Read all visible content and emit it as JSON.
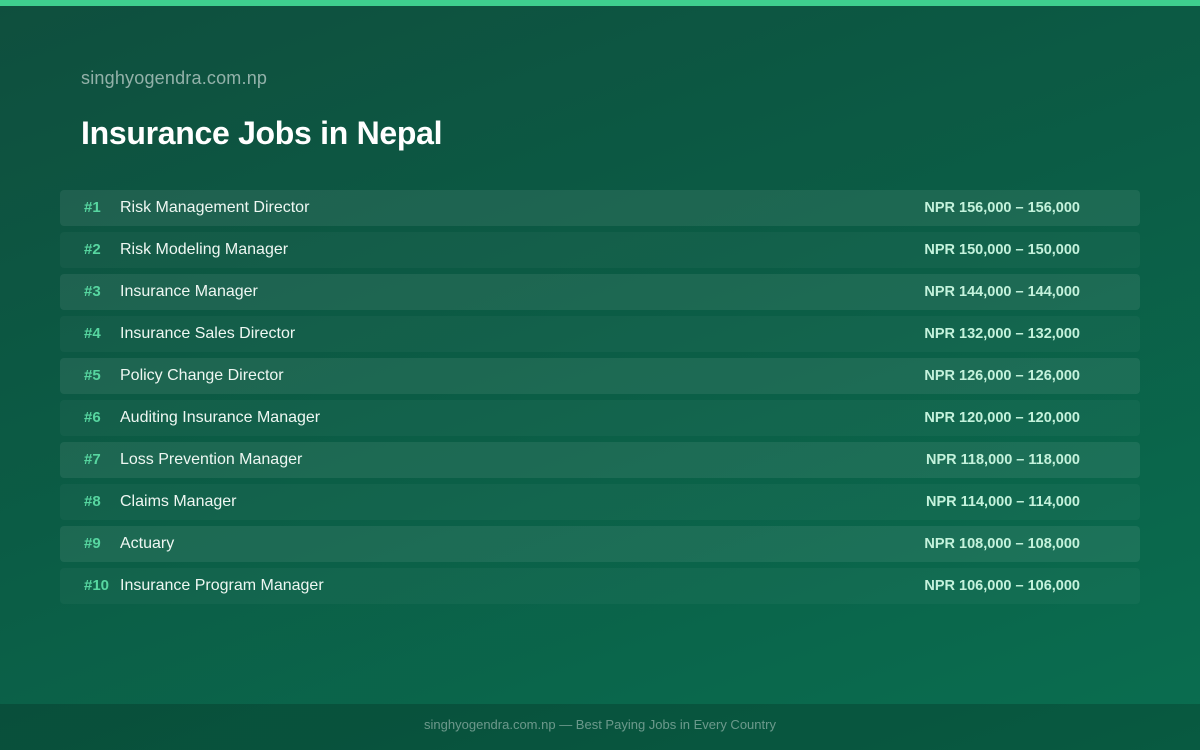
{
  "header": {
    "site_name": "singhyogendra.com.np",
    "title": "Insurance Jobs in Nepal"
  },
  "colors": {
    "accent": "#3ecf8e",
    "rank": "#57d6a0",
    "background_start": "#0f4f3e",
    "background_end": "#0a6e50"
  },
  "jobs": [
    {
      "rank": "#1",
      "title": "Risk Management Director",
      "salary": "NPR 156,000 – 156,000"
    },
    {
      "rank": "#2",
      "title": "Risk Modeling Manager",
      "salary": "NPR 150,000 – 150,000"
    },
    {
      "rank": "#3",
      "title": "Insurance Manager",
      "salary": "NPR 144,000 – 144,000"
    },
    {
      "rank": "#4",
      "title": "Insurance Sales Director",
      "salary": "NPR 132,000 – 132,000"
    },
    {
      "rank": "#5",
      "title": "Policy Change Director",
      "salary": "NPR 126,000 – 126,000"
    },
    {
      "rank": "#6",
      "title": "Auditing Insurance Manager",
      "salary": "NPR 120,000 – 120,000"
    },
    {
      "rank": "#7",
      "title": "Loss Prevention Manager",
      "salary": "NPR 118,000 – 118,000"
    },
    {
      "rank": "#8",
      "title": "Claims Manager",
      "salary": "NPR 114,000 – 114,000"
    },
    {
      "rank": "#9",
      "title": "Actuary",
      "salary": "NPR 108,000 – 108,000"
    },
    {
      "rank": "#10",
      "title": "Insurance Program Manager",
      "salary": "NPR 106,000 – 106,000"
    }
  ],
  "footer": {
    "text": "singhyogendra.com.np — Best Paying Jobs in Every Country"
  }
}
